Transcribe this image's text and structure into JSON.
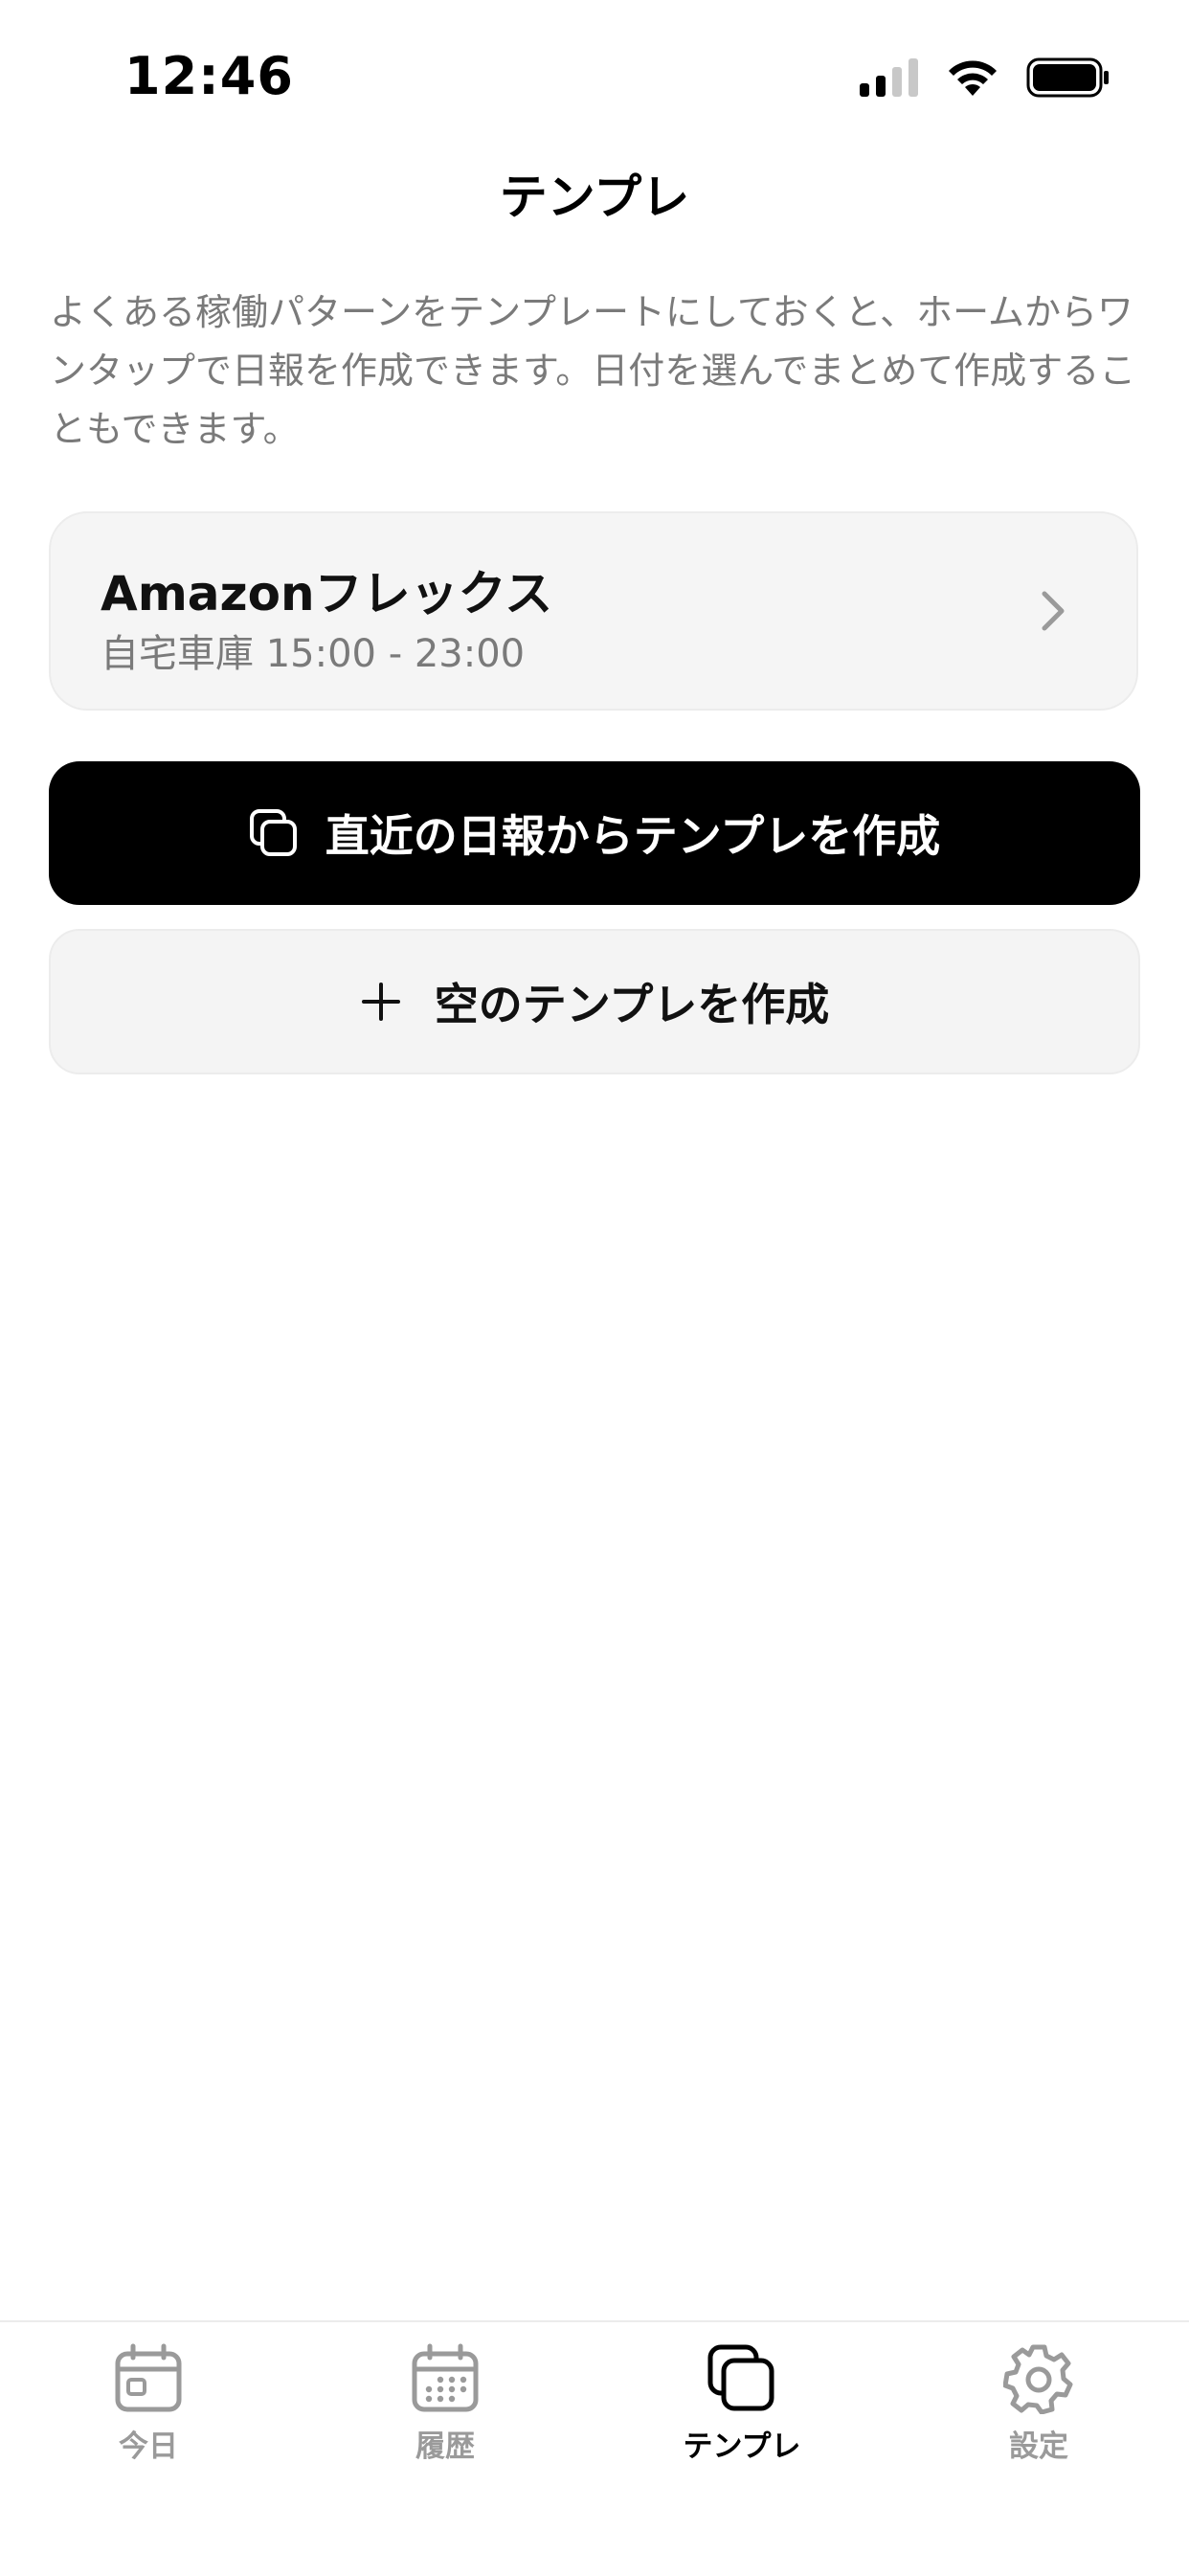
{
  "status_bar": {
    "time": "12:46",
    "signal_icon": "cellular-signal-icon",
    "wifi_icon": "wifi-icon",
    "battery_icon": "battery-icon"
  },
  "nav": {
    "title": "テンプレ"
  },
  "description": "よくある稼働パターンをテンプレートにしておくと、ホームからワンタップで日報を作成できます。日付を選んでまとめて作成することもできます。",
  "templates": [
    {
      "name": "Amazonフレックス",
      "detail": "自宅車庫 15:00 - 23:00"
    }
  ],
  "actions": {
    "create_from_recent": "直近の日報からテンプレを作成",
    "create_empty": "空のテンプレを作成"
  },
  "tab_bar": {
    "active": "templates",
    "tabs": [
      {
        "id": "today",
        "label": "今日",
        "icon": "calendar-today-icon"
      },
      {
        "id": "history",
        "label": "履歴",
        "icon": "calendar-grid-icon"
      },
      {
        "id": "templates",
        "label": "テンプレ",
        "icon": "stacked-squares-icon"
      },
      {
        "id": "settings",
        "label": "設定",
        "icon": "gear-icon"
      }
    ]
  },
  "colors": {
    "primary_button": "#000000",
    "card_background": "#f5f5f5",
    "secondary_text": "#7a7a7a",
    "inactive_tab": "#9a9a9a"
  }
}
